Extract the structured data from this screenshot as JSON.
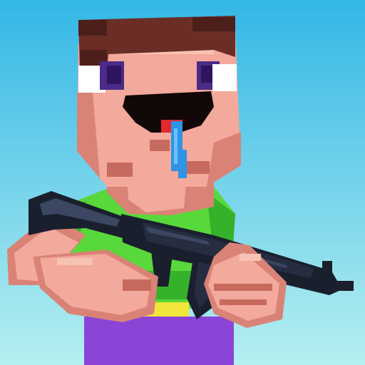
{
  "app": {
    "type": "game-icon",
    "texts": []
  },
  "palette": {
    "sky_top": "#33b7e6",
    "sky_bottom": "#b6eff0",
    "hair": "#6a2e26",
    "hair_dark": "#4d1f1a",
    "skin": "#f3a99b",
    "skin_light": "#f8c2b4",
    "skin_shadow": "#d98376",
    "skin_deep": "#c76a5e",
    "eye_white": "#ffffff",
    "eye_purple": "#4b2a88",
    "eye_purple_dark": "#2f1560",
    "mouth": "#120808",
    "tongue": "#e3282e",
    "drool": "#2f93e6",
    "drool_light": "#6cc0ff",
    "shirt": "#58d83a",
    "shirt_dark": "#35b22a",
    "pants": "#8a45d6",
    "belt": "#f2e63a",
    "gun": "#1a1f2e",
    "gun_mid": "#262d41",
    "gun_highlight": "#3b4662"
  },
  "icons": {
    "character": "noob-blocky-character",
    "weapon": "assault-rifle"
  }
}
